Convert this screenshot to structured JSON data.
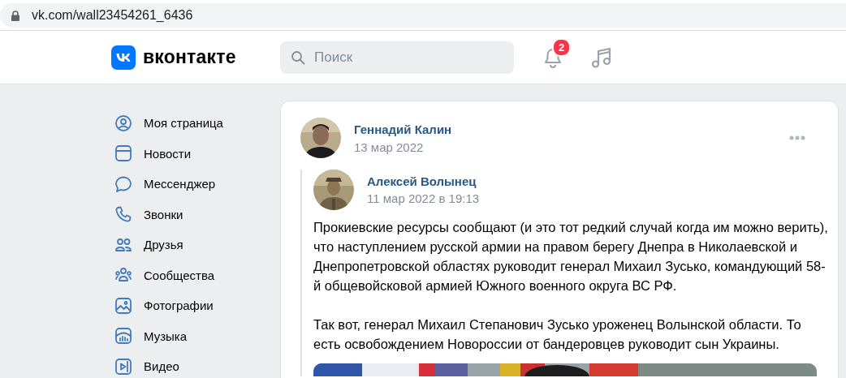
{
  "address_bar": {
    "url": "vk.com/wall23454261_6436"
  },
  "header": {
    "logo_text": "вконтакте",
    "search": {
      "placeholder": "Поиск"
    },
    "notifications_badge": "2"
  },
  "sidebar": {
    "items": [
      {
        "kind": "profile",
        "label": "Моя страница"
      },
      {
        "kind": "news",
        "label": "Новости"
      },
      {
        "kind": "messenger",
        "label": "Мессенджер"
      },
      {
        "kind": "calls",
        "label": "Звонки"
      },
      {
        "kind": "friends",
        "label": "Друзья"
      },
      {
        "kind": "communities",
        "label": "Сообщества"
      },
      {
        "kind": "photos",
        "label": "Фотографии"
      },
      {
        "kind": "music",
        "label": "Музыка"
      },
      {
        "kind": "video",
        "label": "Видео"
      }
    ]
  },
  "post": {
    "author": "Геннадий Калин",
    "date": "13 мар 2022",
    "repost": {
      "author": "Алексей Волынец",
      "date": "11 мар 2022 в 19:13",
      "paragraphs": [
        "Прокиевские ресурсы сообщают (и это тот редкий случай когда им можно верить), что наступлением русской армии на правом берегу Днепра в Николаевской и Днепропетровской областях руководит генерал Михаил Зусько, командующий 58-й общевойсковой армией Южного военного округа ВС РФ.",
        "Так вот, генерал Михаил Степанович Зусько уроженец Волынской области. То есть освобождением Новороссии от бандеровцев руководит сын Украины."
      ]
    }
  }
}
